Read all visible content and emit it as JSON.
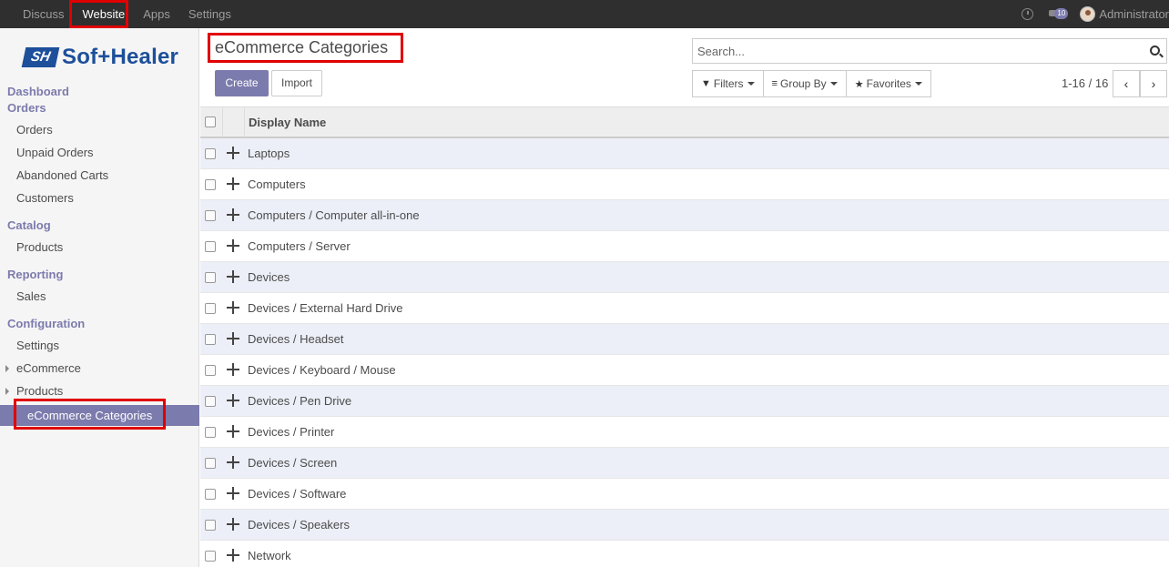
{
  "topbar": {
    "menu": [
      "Discuss",
      "Website",
      "Apps",
      "Settings"
    ],
    "active": "Website",
    "message_count": "10",
    "user": "Administrator"
  },
  "sidebar": {
    "logo_mark": "SH",
    "logo_text": "Sof+Healer",
    "sections": [
      {
        "title": "Dashboard"
      },
      {
        "title": "Orders",
        "items": [
          "Orders",
          "Unpaid Orders",
          "Abandoned Carts",
          "Customers"
        ]
      },
      {
        "title": "Catalog",
        "items": [
          "Products"
        ]
      },
      {
        "title": "Reporting",
        "items": [
          "Sales"
        ]
      },
      {
        "title": "Configuration",
        "items": [
          "Settings",
          "eCommerce",
          "Products",
          "eCommerce Categories"
        ]
      }
    ],
    "active_item": "eCommerce Categories"
  },
  "control_panel": {
    "title": "eCommerce Categories",
    "create_label": "Create",
    "import_label": "Import",
    "search_placeholder": "Search...",
    "filters_label": "Filters",
    "groupby_label": "Group By",
    "favorites_label": "Favorites",
    "pager": "1-16 / 16"
  },
  "list": {
    "column": "Display Name",
    "rows": [
      "Laptops",
      "Computers",
      "Computers / Computer all-in-one",
      "Computers / Server",
      "Devices",
      "Devices / External Hard Drive",
      "Devices / Headset",
      "Devices / Keyboard / Mouse",
      "Devices / Pen Drive",
      "Devices / Printer",
      "Devices / Screen",
      "Devices / Software",
      "Devices / Speakers",
      "Network"
    ]
  },
  "colors": {
    "accent": "#7c7bad",
    "topbar": "#2f2f2f",
    "highlight": "#e00000",
    "brand": "#1d4f9a"
  }
}
